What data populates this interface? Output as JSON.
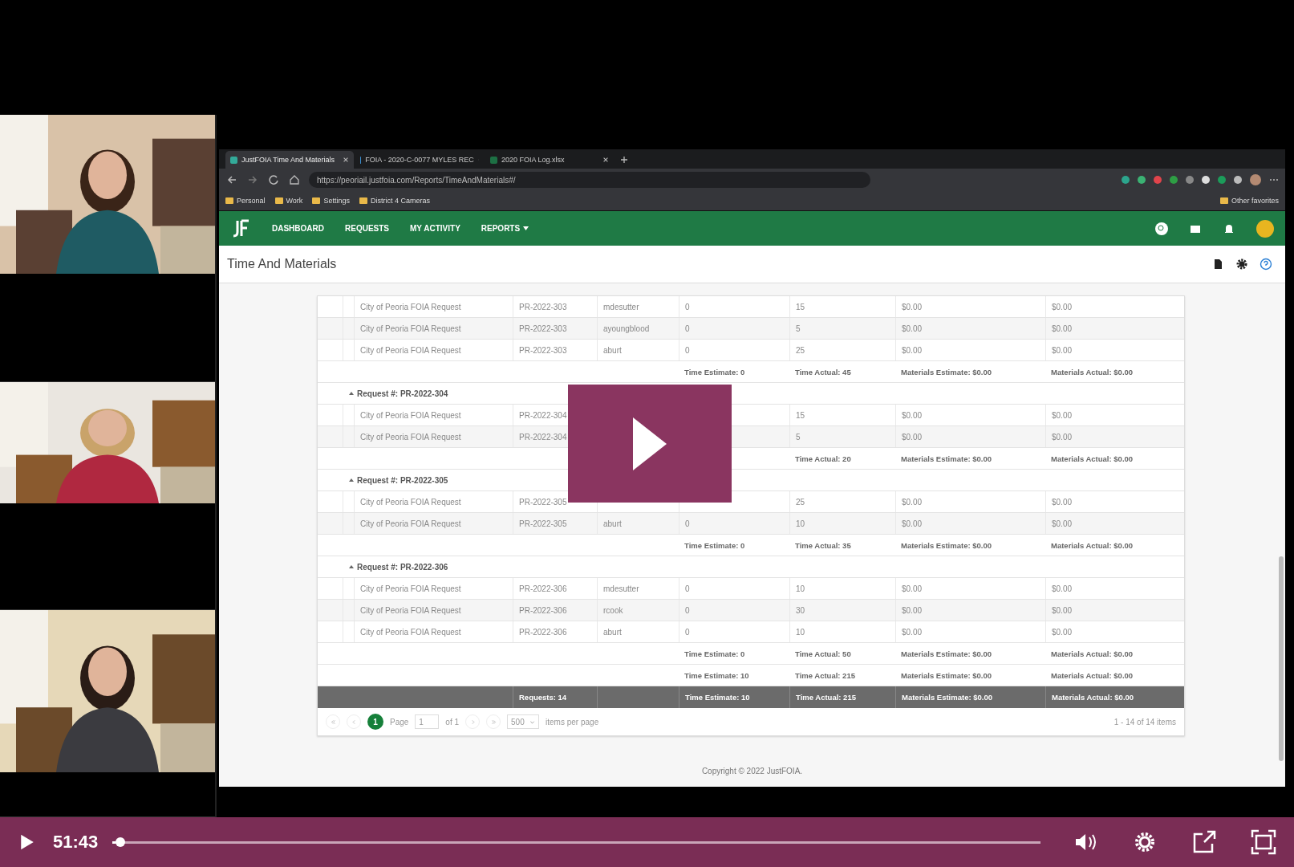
{
  "browser": {
    "tabs": [
      {
        "label": "JustFOIA Time And Materials",
        "selected": true
      },
      {
        "label": "FOIA - 2020-C-0077 MYLES REC",
        "selected": false
      },
      {
        "label": "2020 FOIA Log.xlsx",
        "selected": false
      }
    ],
    "address": "https://peoriail.justfoia.com/Reports/TimeAndMaterials#/",
    "bookmarks": [
      "Personal",
      "Work",
      "Settings",
      "District 4 Cameras"
    ],
    "other_favorites": "Other favorites"
  },
  "app": {
    "nav": [
      {
        "label": "DASHBOARD",
        "kind": "link"
      },
      {
        "label": "REQUESTS",
        "kind": "link"
      },
      {
        "label": "MY ACTIVITY",
        "kind": "link"
      },
      {
        "label": "REPORTS",
        "kind": "dropdown"
      }
    ],
    "page_title": "Time And Materials"
  },
  "groups": [
    {
      "rows": [
        [
          "City of Peoria FOIA Request",
          "PR-2022-303",
          "mdesutter",
          "0",
          "15",
          "$0.00",
          "$0.00"
        ],
        [
          "City of Peoria FOIA Request",
          "PR-2022-303",
          "ayoungblood",
          "0",
          "5",
          "$0.00",
          "$0.00"
        ],
        [
          "City of Peoria FOIA Request",
          "PR-2022-303",
          "aburt",
          "0",
          "25",
          "$0.00",
          "$0.00"
        ]
      ],
      "summary": [
        "Time Estimate: 0",
        "Time Actual: 45",
        "Materials Estimate: $0.00",
        "Materials Actual: $0.00"
      ]
    },
    {
      "header": "Request #: PR-2022-304",
      "expanded": true,
      "rows": [
        [
          "City of Peoria FOIA Request",
          "PR-2022-304",
          null,
          null,
          "15",
          "$0.00",
          "$0.00"
        ],
        [
          "City of Peoria FOIA Request",
          "PR-2022-304",
          null,
          null,
          "5",
          "$0.00",
          "$0.00"
        ]
      ],
      "summary": {
        "time_actual": "Time Actual: 20",
        "materials_estimate": "Materials Estimate: $0.00",
        "materials_actual": "Materials Actual: $0.00"
      }
    },
    {
      "header": "Request #: PR-2022-305",
      "expanded": true,
      "rows": [
        [
          "City of Peoria FOIA Request",
          "PR-2022-305",
          null,
          null,
          "25",
          "$0.00",
          "$0.00"
        ],
        [
          "City of Peoria FOIA Request",
          "PR-2022-305",
          "aburt",
          "0",
          "10",
          "$0.00",
          "$0.00"
        ]
      ],
      "summary": [
        "Time Estimate: 0",
        "Time Actual: 35",
        "Materials Estimate: $0.00",
        "Materials Actual: $0.00"
      ]
    },
    {
      "header": "Request #: PR-2022-306",
      "expanded": true,
      "rows": [
        [
          "City of Peoria FOIA Request",
          "PR-2022-306",
          "mdesutter",
          "0",
          "10",
          "$0.00",
          "$0.00"
        ],
        [
          "City of Peoria FOIA Request",
          "PR-2022-306",
          "rcook",
          "0",
          "30",
          "$0.00",
          "$0.00"
        ],
        [
          "City of Peoria FOIA Request",
          "PR-2022-306",
          "aburt",
          "0",
          "10",
          "$0.00",
          "$0.00"
        ]
      ],
      "summary": [
        "Time Estimate: 0",
        "Time Actual: 50",
        "Materials Estimate: $0.00",
        "Materials Actual: $0.00"
      ]
    }
  ],
  "grand_summary": [
    "Time Estimate: 10",
    "Time Actual: 215",
    "Materials Estimate: $0.00",
    "Materials Actual: $0.00"
  ],
  "footer": {
    "requests": "Requests: 14",
    "totals": [
      "Time Estimate: 10",
      "Time Actual: 215",
      "Materials Estimate: $0.00",
      "Materials Actual: $0.00"
    ]
  },
  "pager": {
    "current": "1",
    "page_label": "Page",
    "page_value": "1",
    "of": "of 1",
    "page_size": "500",
    "per_page": "items per page",
    "range": "1 - 14 of 14 items"
  },
  "copyright": "Copyright © 2022 JustFOIA.",
  "player": {
    "time": "51:43",
    "level": 0.003,
    "webcams": [
      {
        "kind": "picture"
      },
      {
        "kind": "picture"
      },
      {
        "kind": "picture"
      }
    ]
  }
}
